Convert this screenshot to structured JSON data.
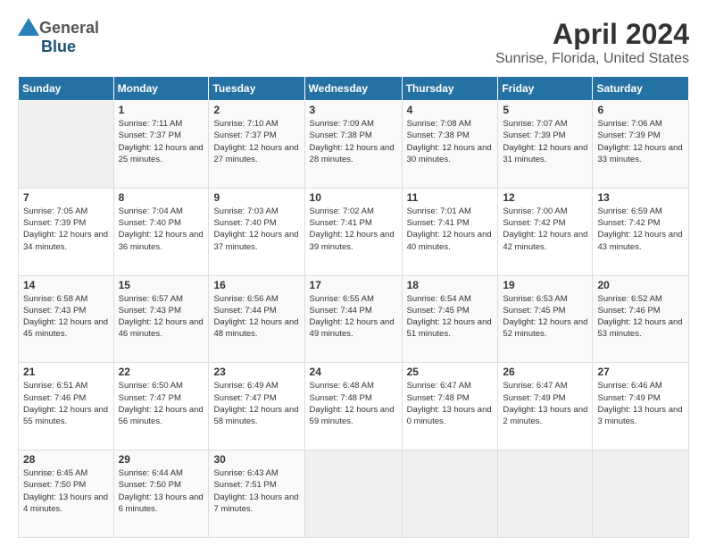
{
  "header": {
    "logo_general": "General",
    "logo_blue": "Blue",
    "main_title": "April 2024",
    "subtitle": "Sunrise, Florida, United States"
  },
  "calendar": {
    "days_of_week": [
      "Sunday",
      "Monday",
      "Tuesday",
      "Wednesday",
      "Thursday",
      "Friday",
      "Saturday"
    ],
    "weeks": [
      [
        {
          "day": "",
          "empty": true
        },
        {
          "day": "1",
          "sunrise": "Sunrise: 7:11 AM",
          "sunset": "Sunset: 7:37 PM",
          "daylight": "Daylight: 12 hours and 25 minutes."
        },
        {
          "day": "2",
          "sunrise": "Sunrise: 7:10 AM",
          "sunset": "Sunset: 7:37 PM",
          "daylight": "Daylight: 12 hours and 27 minutes."
        },
        {
          "day": "3",
          "sunrise": "Sunrise: 7:09 AM",
          "sunset": "Sunset: 7:38 PM",
          "daylight": "Daylight: 12 hours and 28 minutes."
        },
        {
          "day": "4",
          "sunrise": "Sunrise: 7:08 AM",
          "sunset": "Sunset: 7:38 PM",
          "daylight": "Daylight: 12 hours and 30 minutes."
        },
        {
          "day": "5",
          "sunrise": "Sunrise: 7:07 AM",
          "sunset": "Sunset: 7:39 PM",
          "daylight": "Daylight: 12 hours and 31 minutes."
        },
        {
          "day": "6",
          "sunrise": "Sunrise: 7:06 AM",
          "sunset": "Sunset: 7:39 PM",
          "daylight": "Daylight: 12 hours and 33 minutes."
        }
      ],
      [
        {
          "day": "7",
          "sunrise": "Sunrise: 7:05 AM",
          "sunset": "Sunset: 7:39 PM",
          "daylight": "Daylight: 12 hours and 34 minutes."
        },
        {
          "day": "8",
          "sunrise": "Sunrise: 7:04 AM",
          "sunset": "Sunset: 7:40 PM",
          "daylight": "Daylight: 12 hours and 36 minutes."
        },
        {
          "day": "9",
          "sunrise": "Sunrise: 7:03 AM",
          "sunset": "Sunset: 7:40 PM",
          "daylight": "Daylight: 12 hours and 37 minutes."
        },
        {
          "day": "10",
          "sunrise": "Sunrise: 7:02 AM",
          "sunset": "Sunset: 7:41 PM",
          "daylight": "Daylight: 12 hours and 39 minutes."
        },
        {
          "day": "11",
          "sunrise": "Sunrise: 7:01 AM",
          "sunset": "Sunset: 7:41 PM",
          "daylight": "Daylight: 12 hours and 40 minutes."
        },
        {
          "day": "12",
          "sunrise": "Sunrise: 7:00 AM",
          "sunset": "Sunset: 7:42 PM",
          "daylight": "Daylight: 12 hours and 42 minutes."
        },
        {
          "day": "13",
          "sunrise": "Sunrise: 6:59 AM",
          "sunset": "Sunset: 7:42 PM",
          "daylight": "Daylight: 12 hours and 43 minutes."
        }
      ],
      [
        {
          "day": "14",
          "sunrise": "Sunrise: 6:58 AM",
          "sunset": "Sunset: 7:43 PM",
          "daylight": "Daylight: 12 hours and 45 minutes."
        },
        {
          "day": "15",
          "sunrise": "Sunrise: 6:57 AM",
          "sunset": "Sunset: 7:43 PM",
          "daylight": "Daylight: 12 hours and 46 minutes."
        },
        {
          "day": "16",
          "sunrise": "Sunrise: 6:56 AM",
          "sunset": "Sunset: 7:44 PM",
          "daylight": "Daylight: 12 hours and 48 minutes."
        },
        {
          "day": "17",
          "sunrise": "Sunrise: 6:55 AM",
          "sunset": "Sunset: 7:44 PM",
          "daylight": "Daylight: 12 hours and 49 minutes."
        },
        {
          "day": "18",
          "sunrise": "Sunrise: 6:54 AM",
          "sunset": "Sunset: 7:45 PM",
          "daylight": "Daylight: 12 hours and 51 minutes."
        },
        {
          "day": "19",
          "sunrise": "Sunrise: 6:53 AM",
          "sunset": "Sunset: 7:45 PM",
          "daylight": "Daylight: 12 hours and 52 minutes."
        },
        {
          "day": "20",
          "sunrise": "Sunrise: 6:52 AM",
          "sunset": "Sunset: 7:46 PM",
          "daylight": "Daylight: 12 hours and 53 minutes."
        }
      ],
      [
        {
          "day": "21",
          "sunrise": "Sunrise: 6:51 AM",
          "sunset": "Sunset: 7:46 PM",
          "daylight": "Daylight: 12 hours and 55 minutes."
        },
        {
          "day": "22",
          "sunrise": "Sunrise: 6:50 AM",
          "sunset": "Sunset: 7:47 PM",
          "daylight": "Daylight: 12 hours and 56 minutes."
        },
        {
          "day": "23",
          "sunrise": "Sunrise: 6:49 AM",
          "sunset": "Sunset: 7:47 PM",
          "daylight": "Daylight: 12 hours and 58 minutes."
        },
        {
          "day": "24",
          "sunrise": "Sunrise: 6:48 AM",
          "sunset": "Sunset: 7:48 PM",
          "daylight": "Daylight: 12 hours and 59 minutes."
        },
        {
          "day": "25",
          "sunrise": "Sunrise: 6:47 AM",
          "sunset": "Sunset: 7:48 PM",
          "daylight": "Daylight: 13 hours and 0 minutes."
        },
        {
          "day": "26",
          "sunrise": "Sunrise: 6:47 AM",
          "sunset": "Sunset: 7:49 PM",
          "daylight": "Daylight: 13 hours and 2 minutes."
        },
        {
          "day": "27",
          "sunrise": "Sunrise: 6:46 AM",
          "sunset": "Sunset: 7:49 PM",
          "daylight": "Daylight: 13 hours and 3 minutes."
        }
      ],
      [
        {
          "day": "28",
          "sunrise": "Sunrise: 6:45 AM",
          "sunset": "Sunset: 7:50 PM",
          "daylight": "Daylight: 13 hours and 4 minutes."
        },
        {
          "day": "29",
          "sunrise": "Sunrise: 6:44 AM",
          "sunset": "Sunset: 7:50 PM",
          "daylight": "Daylight: 13 hours and 6 minutes."
        },
        {
          "day": "30",
          "sunrise": "Sunrise: 6:43 AM",
          "sunset": "Sunset: 7:51 PM",
          "daylight": "Daylight: 13 hours and 7 minutes."
        },
        {
          "day": "",
          "empty": true
        },
        {
          "day": "",
          "empty": true
        },
        {
          "day": "",
          "empty": true
        },
        {
          "day": "",
          "empty": true
        }
      ]
    ]
  }
}
